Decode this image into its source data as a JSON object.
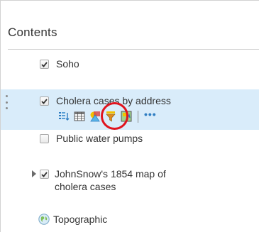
{
  "panel": {
    "title": "Contents"
  },
  "layers": [
    {
      "label": "Soho",
      "checked": true
    },
    {
      "label": "Cholera cases by address",
      "checked": true,
      "selected": true
    },
    {
      "label": "Public water pumps",
      "checked": false
    },
    {
      "label_line1": "JohnSnow's 1854 map of",
      "label_line2": "cholera cases",
      "checked": true,
      "expandable": true
    }
  ],
  "toolbar": {
    "tools": [
      "show-table-icon",
      "table-icon",
      "change-style-icon",
      "filter-icon",
      "perform-analysis-icon"
    ],
    "more_label": "•••",
    "highlighted_tool": "change-style-icon"
  },
  "basemap": {
    "label": "Topographic",
    "icon": "globe-icon"
  },
  "colors": {
    "selected_bg": "#d9ecfa",
    "accent": "#2f7ec2",
    "highlight_ring": "#e0141e"
  }
}
